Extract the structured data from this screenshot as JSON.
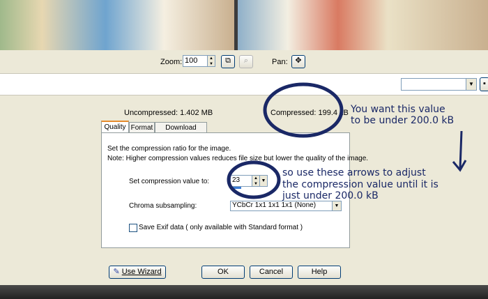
{
  "zoom": {
    "label": "Zoom:",
    "value": "100"
  },
  "pan": {
    "label": "Pan:"
  },
  "sizes": {
    "uncompressed": "Uncompressed:  1.402 MB",
    "compressed": "Compressed: 199.4 kB"
  },
  "tabs": [
    {
      "label": "Quality"
    },
    {
      "label": "Format"
    },
    {
      "label": "Download Times"
    }
  ],
  "panel": {
    "desc1": "Set the compression ratio for the image.",
    "desc2": "Note:  Higher compression values reduces file size but lower the quality of the image.",
    "compression_label": "Set compression value to:",
    "compression_value": "23",
    "chroma_label": "Chroma subsampling:",
    "chroma_value": "YCbCr 1x1  1x1  1x1 (None)",
    "exif_label": "Save Exif data ( only available with Standard format )"
  },
  "buttons": {
    "wizard": "Use Wizard",
    "ok": "OK",
    "cancel": "Cancel",
    "help": "Help"
  },
  "annotations": {
    "note1_line1": "You want this value",
    "note1_line2": "to be under 200.0 kB",
    "note2_line1": "so use these arrows to adjust",
    "note2_line2": "the compression value until it is",
    "note2_line3": "just under 200.0 kB"
  },
  "colors": {
    "ink": "#1a2866",
    "xp_border": "#003c74"
  }
}
